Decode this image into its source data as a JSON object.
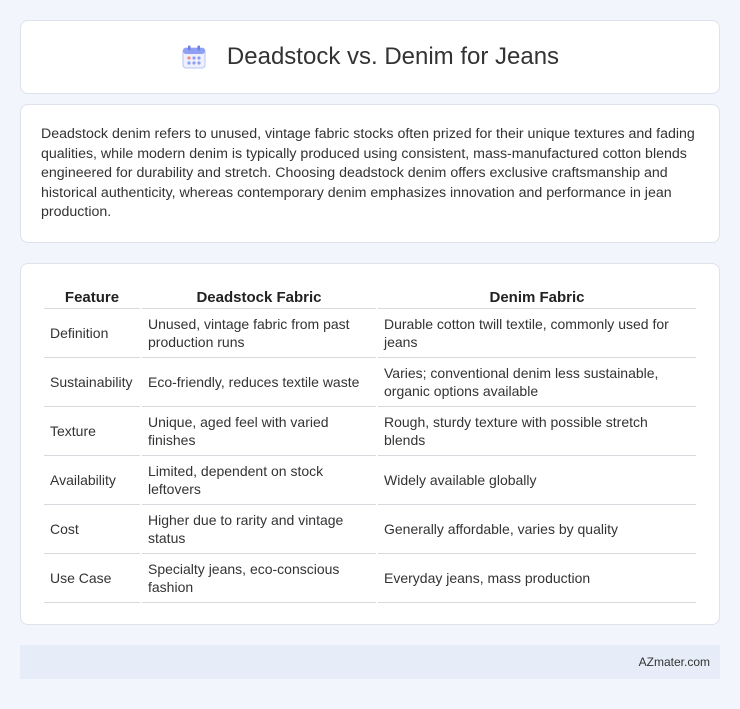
{
  "header": {
    "title": "Deadstock vs. Denim for Jeans",
    "icon": "calendar-icon"
  },
  "intro": {
    "text": "Deadstock denim refers to unused, vintage fabric stocks often prized for their unique textures and fading qualities, while modern denim is typically produced using consistent, mass-manufactured cotton blends engineered for durability and stretch. Choosing deadstock denim offers exclusive craftsmanship and historical authenticity, whereas contemporary denim emphasizes innovation and performance in jean production."
  },
  "table": {
    "headers": [
      "Feature",
      "Deadstock Fabric",
      "Denim Fabric"
    ],
    "rows": [
      [
        "Definition",
        "Unused, vintage fabric from past production runs",
        "Durable cotton twill textile, commonly used for jeans"
      ],
      [
        "Sustainability",
        "Eco-friendly, reduces textile waste",
        "Varies; conventional denim less sustainable, organic options available"
      ],
      [
        "Texture",
        "Unique, aged feel with varied finishes",
        "Rough, sturdy texture with possible stretch blends"
      ],
      [
        "Availability",
        "Limited, dependent on stock leftovers",
        "Widely available globally"
      ],
      [
        "Cost",
        "Higher due to rarity and vintage status",
        "Generally affordable, varies by quality"
      ],
      [
        "Use Case",
        "Specialty jeans, eco-conscious fashion",
        "Everyday jeans, mass production"
      ]
    ]
  },
  "footer": {
    "brand": "AZmater.com"
  },
  "colors": {
    "background": "#f2f5fb",
    "card": "#ffffff",
    "footer_bg": "#e7edf8",
    "icon_accent": "#7d8ff0"
  }
}
